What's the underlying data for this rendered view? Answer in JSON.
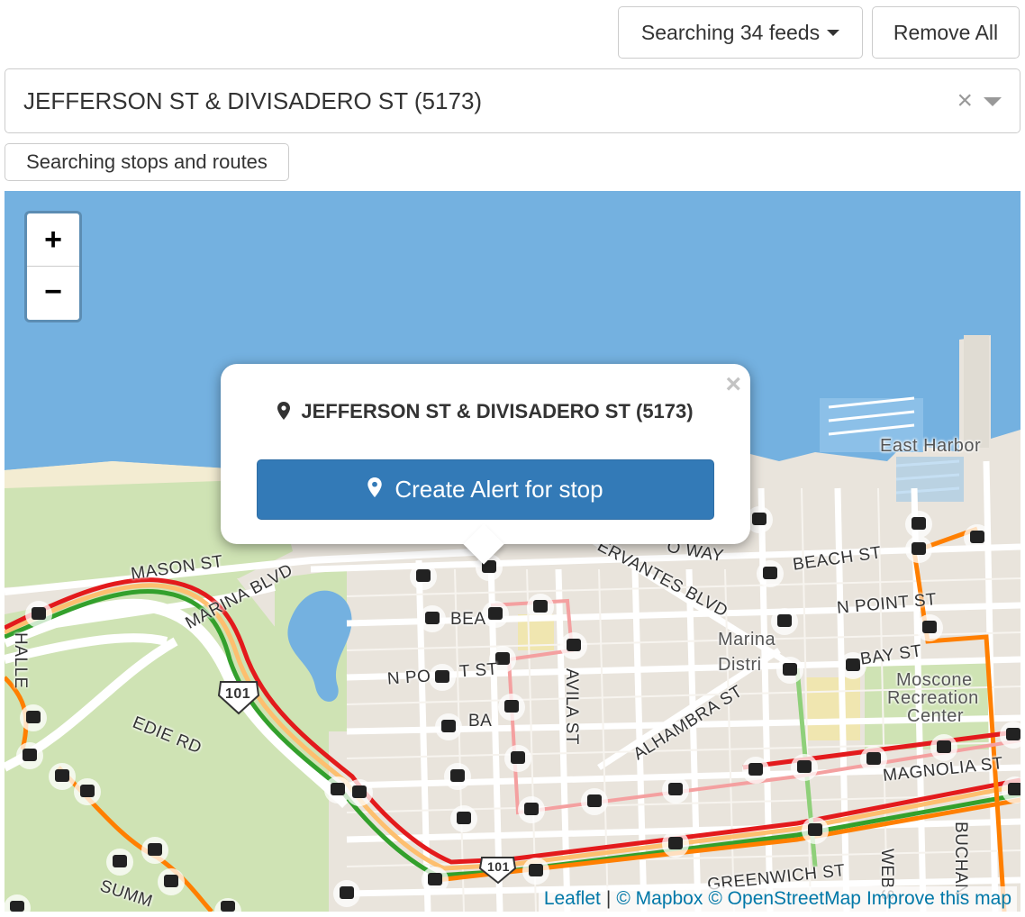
{
  "toolbar": {
    "feeds_label": "Searching 34 feeds",
    "remove_label": "Remove All"
  },
  "stop_select": {
    "value": "JEFFERSON ST & DIVISADERO ST (5173)",
    "clear_symbol": "×"
  },
  "search_mode": {
    "label": "Searching stops and routes"
  },
  "map": {
    "zoom_in": "+",
    "zoom_out": "−",
    "labels": {
      "mason_st": "MASON ST",
      "marina_blvd": "MARINA BLVD",
      "beach_st_1": "BEA",
      "n_point_st_1": "N PO",
      "n_point_st_1b": "T ST",
      "bay_st_1": "BA",
      "cervantes_blvd": "ERVANTES BLVD",
      "o_way": "O WAY",
      "avila_st": "AVILA ST",
      "alhambra_st": "ALHAMBRA ST",
      "marina_district_1": "Marina",
      "marina_district_2": "Distri",
      "beach_st_2": "BEACH ST",
      "n_point_st_2": "N POINT ST",
      "bay_st_2": "BAY ST",
      "moscone_1": "Moscone",
      "moscone_2": "Recreation",
      "moscone_3": "Center",
      "east_harbor": "East Harbor",
      "magnolia_st": "MAGNOLIA ST",
      "greenwich_st": "GREENWICH ST",
      "edie_rd": "EDIE RD",
      "halleck": "HALLE",
      "summ": "SUMM",
      "webster": "WEBS",
      "buchanan": "BUCHAN",
      "hwy_101": "101",
      "hwy_101b": "101"
    },
    "colors": {
      "water": "#74b1e0",
      "land": "#e9e4dc",
      "park": "#cfe3b4",
      "route_red": "#e31a1c",
      "route_orange": "#ff7f00",
      "route_green": "#33a02c",
      "route_pink": "#f4a0a0",
      "route_light_orange": "#fdbf6f"
    }
  },
  "popup": {
    "close_symbol": "×",
    "stop_name": "JEFFERSON ST & DIVISADERO ST (5173)",
    "button_label": "Create Alert for stop",
    "pin_icon": "map-marker-icon"
  },
  "attribution": {
    "leaflet": "Leaflet",
    "sep": "|",
    "mapbox": "© Mapbox",
    "osm": "© OpenStreetMap",
    "improve": "Improve this map"
  }
}
